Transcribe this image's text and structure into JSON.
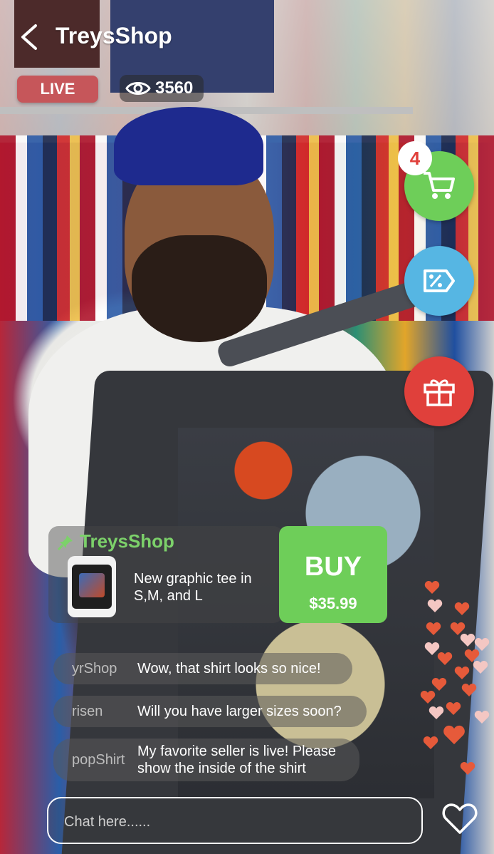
{
  "header": {
    "back_icon": "chevron-left-icon",
    "shop_name": "TreysShop",
    "live_label": "LIVE",
    "viewer_count": "3560",
    "viewer_icon": "eye-icon"
  },
  "actions": {
    "cart_count": "4",
    "cart_icon": "shopping-cart-icon",
    "coupon_icon": "discount-tag-icon",
    "gift_icon": "gift-icon"
  },
  "product": {
    "seller": "TreysShop",
    "pin_icon": "pin-icon",
    "description": "New graphic tee in S,M, and L",
    "buy_label": "BUY",
    "price": "$35.99"
  },
  "chat": {
    "messages": [
      {
        "user": "yrShop",
        "text": "Wow, that shirt looks so nice!"
      },
      {
        "user": "risen",
        "text": "Will you have larger sizes soon?"
      },
      {
        "user": "popShirt",
        "text": "My favorite seller is live! Please show the inside of the shirt"
      }
    ],
    "input_placeholder": "Chat here......",
    "like_icon": "heart-outline-icon"
  },
  "colors": {
    "accent_green": "#6ece59",
    "coupon_blue": "#56b6e3",
    "gift_red": "#e0403b",
    "live_red": "#c6565a"
  }
}
